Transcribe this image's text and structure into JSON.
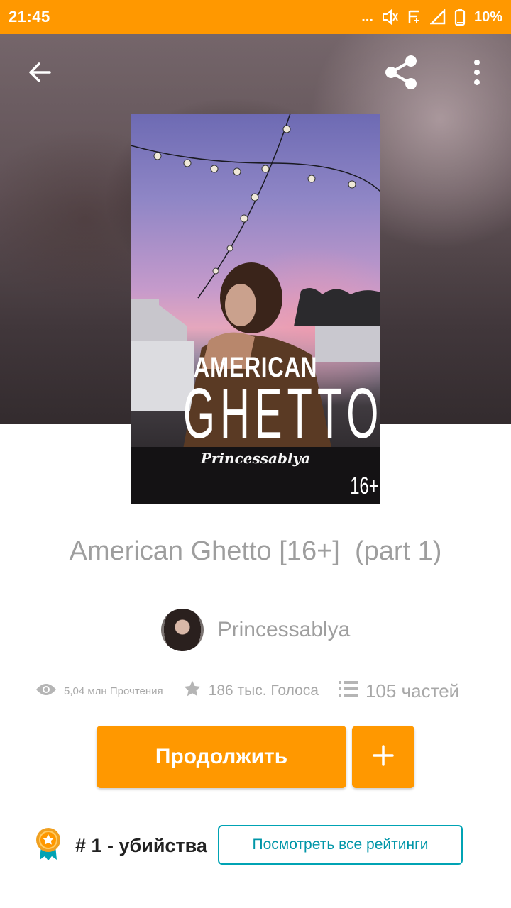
{
  "status_bar": {
    "time": "21:45",
    "overflow": "...",
    "battery": "10%",
    "icons": [
      "mute-icon",
      "signal-e-icon",
      "cell-signal-icon",
      "battery-icon"
    ]
  },
  "top_bar": {
    "icons": [
      "back-arrow-icon",
      "share-icon",
      "more-vert-icon"
    ]
  },
  "cover": {
    "title_line_1": "AMERICAN",
    "title_line_2": "GHETTO",
    "author": "Princessablya",
    "age_label": "16+"
  },
  "story": {
    "title": "American Ghetto [16+]  (part 1)",
    "author": "Princessablya"
  },
  "stats": {
    "reads": "5,04 млн Прочтения",
    "votes": "186 тыс. Голоса",
    "parts": "105 частей"
  },
  "actions": {
    "continue_label": "Продолжить",
    "add_label": "+"
  },
  "ranking": {
    "rank_text": "# 1 - убийства",
    "see_all_label": "Посмотреть все рейтинги"
  },
  "colors": {
    "accent": "#ff9800",
    "teal": "#00a3b4",
    "muted_text": "#9e9e9e"
  }
}
